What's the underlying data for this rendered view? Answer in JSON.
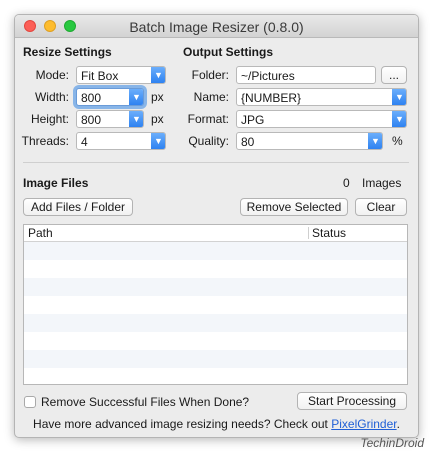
{
  "window": {
    "title": "Batch Image Resizer (0.8.0)"
  },
  "resize": {
    "heading": "Resize Settings",
    "mode_label": "Mode:",
    "mode_value": "Fit Box",
    "width_label": "Width:",
    "width_value": "800",
    "width_unit": "px",
    "height_label": "Height:",
    "height_value": "800",
    "height_unit": "px",
    "threads_label": "Threads:",
    "threads_value": "4"
  },
  "output": {
    "heading": "Output Settings",
    "folder_label": "Folder:",
    "folder_value": "~/Pictures",
    "browse_label": "...",
    "name_label": "Name:",
    "name_value": "{NUMBER}",
    "format_label": "Format:",
    "format_value": "JPG",
    "quality_label": "Quality:",
    "quality_value": "80",
    "quality_unit": "%"
  },
  "files": {
    "heading": "Image Files",
    "count": "0",
    "count_label": "Images",
    "add_button": "Add Files / Folder",
    "remove_button": "Remove Selected",
    "clear_button": "Clear",
    "columns": [
      "Path",
      "Status"
    ],
    "rows": []
  },
  "footer": {
    "remove_done_label": "Remove Successful Files When Done?",
    "remove_done_checked": false,
    "start_button": "Start Processing",
    "promo_text": "Have more advanced image resizing needs? Check out",
    "promo_link": "PixelGrinder",
    "promo_end": "."
  },
  "watermark": "TechinDroid",
  "icons": {
    "dropdown": "chevron-down-icon"
  },
  "colors": {
    "accent": "#2a7ff0",
    "focus": "#88b5e8",
    "link": "#1f5fd6"
  }
}
